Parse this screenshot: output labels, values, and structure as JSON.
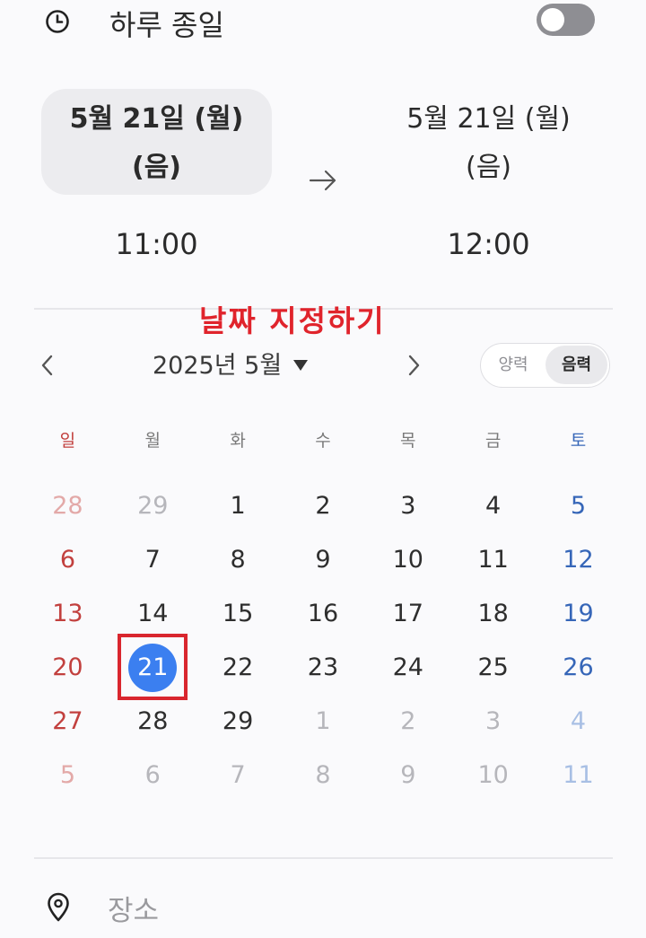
{
  "all_day": {
    "icon": "clock-icon",
    "label": "하루 종일",
    "toggle_on": false
  },
  "range": {
    "start": {
      "date": "5월 21일 (월)",
      "lunar": "(음)",
      "time": "11:00"
    },
    "end": {
      "date": "5월 21일 (월)",
      "lunar": "(음)",
      "time": "12:00"
    },
    "arrow_icon": "arrow-right-icon"
  },
  "annotation": "날짜 지정하기",
  "calendar": {
    "month_label": "2025년 5월",
    "solar_label": "양력",
    "lunar_label": "음력",
    "selected_mode": "lunar",
    "weekdays": [
      "일",
      "월",
      "화",
      "수",
      "목",
      "금",
      "토"
    ],
    "weeks": [
      [
        {
          "d": "28",
          "other": true
        },
        {
          "d": "29",
          "other": true
        },
        {
          "d": "1"
        },
        {
          "d": "2"
        },
        {
          "d": "3"
        },
        {
          "d": "4"
        },
        {
          "d": "5"
        }
      ],
      [
        {
          "d": "6"
        },
        {
          "d": "7"
        },
        {
          "d": "8"
        },
        {
          "d": "9"
        },
        {
          "d": "10"
        },
        {
          "d": "11"
        },
        {
          "d": "12"
        }
      ],
      [
        {
          "d": "13"
        },
        {
          "d": "14"
        },
        {
          "d": "15"
        },
        {
          "d": "16"
        },
        {
          "d": "17"
        },
        {
          "d": "18"
        },
        {
          "d": "19"
        }
      ],
      [
        {
          "d": "20"
        },
        {
          "d": "21",
          "selected": true
        },
        {
          "d": "22"
        },
        {
          "d": "23"
        },
        {
          "d": "24"
        },
        {
          "d": "25"
        },
        {
          "d": "26"
        }
      ],
      [
        {
          "d": "27"
        },
        {
          "d": "28"
        },
        {
          "d": "29"
        },
        {
          "d": "1",
          "other": true
        },
        {
          "d": "2",
          "other": true
        },
        {
          "d": "3",
          "other": true
        },
        {
          "d": "4",
          "other": true
        }
      ],
      [
        {
          "d": "5",
          "other": true
        },
        {
          "d": "6",
          "other": true
        },
        {
          "d": "7",
          "other": true
        },
        {
          "d": "8",
          "other": true
        },
        {
          "d": "9",
          "other": true
        },
        {
          "d": "10",
          "other": true
        },
        {
          "d": "11",
          "other": true
        }
      ]
    ],
    "selected_color": "#3b7ff0",
    "sunday_color": "#c2403e",
    "saturday_color": "#3666b8"
  },
  "location": {
    "icon": "location-pin-icon",
    "placeholder": "장소"
  }
}
